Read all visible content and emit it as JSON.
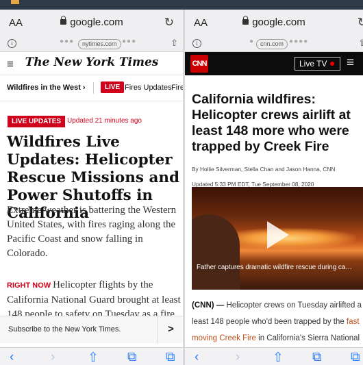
{
  "left": {
    "address": {
      "aa": "AA",
      "domain": "google.com"
    },
    "tab": {
      "pill": "nytimes.com",
      "dots_left": "●●●",
      "dots_right": "●●●"
    },
    "masthead": "The New York Times",
    "subnav": {
      "section": "Wildfires in the West ›",
      "live": "LIVE",
      "item1": "Fires Updates",
      "item2": "Fires"
    },
    "article": {
      "badge": "LIVE UPDATES",
      "updated": "Updated 21 minutes ago",
      "headline": "Wildfires Live Updates: Helicopter Rescue Missions and Power Shutoffs in California",
      "summary": "Extreme weather is battering the Western United States, with fires raging along the Pacific Coast and snow falling in Colorado.",
      "right_now_label": "RIGHT NOW",
      "right_now_text": "Helicopter flights by the California National Guard brought at least 148 people to safety on Tuesday as a fire burned in the Sierra National"
    },
    "subscribe": "Subscribe to the New York Times.",
    "subscribe_arrow": ">"
  },
  "right": {
    "address": {
      "aa": "AA",
      "domain": "google.com"
    },
    "tab": {
      "pill": "cnn.com",
      "dots_left": "●",
      "dots_right": "●●●●"
    },
    "logo": "CNN",
    "live_tv": "Live TV",
    "article": {
      "headline": "California wildfires: Helicopter crews airlift at least 148 more who were trapped by Creek Fire",
      "byline": "By Hollie Silverman, Stella Chan and Jason Hanna, CNN",
      "updated": "Updated 5:33 PM EDT, Tue September 08, 2020",
      "video_caption": "Father captures dramatic wildfire rescue during ca…",
      "lede_source": "(CNN) —",
      "lede_1": "Helicopter crews on Tuesday airlifted a",
      "lede_2a": "least 148 people who'd been trapped by the",
      "lede_2b": "fast",
      "lede_3a": "moving Creek Fire",
      "lede_3b": "in California's Sierra National"
    }
  },
  "toolbar": {
    "back": "‹",
    "forward": "›",
    "share": "⇧",
    "bookmarks": "⧉",
    "tabs": "⧉"
  },
  "colors": {
    "nyt_red": "#d0021b",
    "cnn_red": "#cc0000",
    "safari_blue": "#2d7ff9"
  }
}
